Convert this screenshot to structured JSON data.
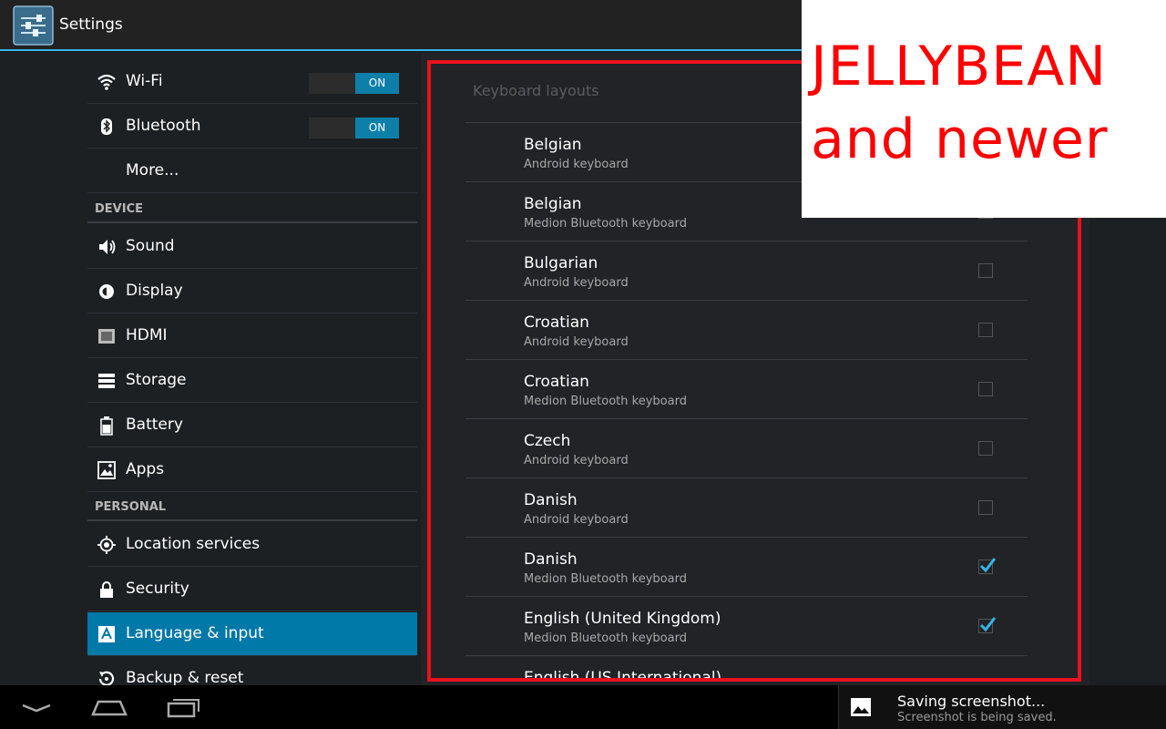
{
  "action_bar": {
    "title": "Settings"
  },
  "left_pane": {
    "items_top": [
      {
        "label": "Wi-Fi",
        "icon": "wifi-icon",
        "toggle": "ON"
      },
      {
        "label": "Bluetooth",
        "icon": "bluetooth-icon",
        "toggle": "ON"
      },
      {
        "label": "More...",
        "icon": ""
      }
    ],
    "device_header": "DEVICE",
    "device_items": [
      {
        "label": "Sound",
        "icon": "sound-icon"
      },
      {
        "label": "Display",
        "icon": "display-icon"
      },
      {
        "label": "HDMI",
        "icon": "hdmi-icon"
      },
      {
        "label": "Storage",
        "icon": "storage-icon"
      },
      {
        "label": "Battery",
        "icon": "battery-icon"
      },
      {
        "label": "Apps",
        "icon": "apps-icon"
      }
    ],
    "personal_header": "PERSONAL",
    "personal_items": [
      {
        "label": "Location services",
        "icon": "location-icon"
      },
      {
        "label": "Security",
        "icon": "lock-icon"
      },
      {
        "label": "Language & input",
        "icon": "language-icon",
        "selected": true
      },
      {
        "label": "Backup & reset",
        "icon": "backup-icon"
      }
    ]
  },
  "keyboard_layouts": {
    "title": "Keyboard layouts",
    "rows": [
      {
        "name": "Belgian",
        "source": "Android keyboard",
        "checked": false
      },
      {
        "name": "Belgian",
        "source": "Medion Bluetooth keyboard",
        "checked": false
      },
      {
        "name": "Bulgarian",
        "source": "Android keyboard",
        "checked": false
      },
      {
        "name": "Croatian",
        "source": "Android keyboard",
        "checked": false
      },
      {
        "name": "Croatian",
        "source": "Medion Bluetooth keyboard",
        "checked": false
      },
      {
        "name": "Czech",
        "source": "Android keyboard",
        "checked": false
      },
      {
        "name": "Danish",
        "source": "Android keyboard",
        "checked": false
      },
      {
        "name": "Danish",
        "source": "Medion Bluetooth keyboard",
        "checked": true
      },
      {
        "name": "English (United Kingdom)",
        "source": "Medion Bluetooth keyboard",
        "checked": true
      },
      {
        "name": "English (US International)",
        "source": "",
        "checked": false
      }
    ]
  },
  "overlay": {
    "line1": "JELLYBEAN",
    "line2": "and newer"
  },
  "notification": {
    "title": "Saving screenshot...",
    "subtitle": "Screenshot is being saved."
  },
  "colors": {
    "accent": "#33b5e5",
    "selected": "#0078a8",
    "annotation": "#e8111d"
  }
}
